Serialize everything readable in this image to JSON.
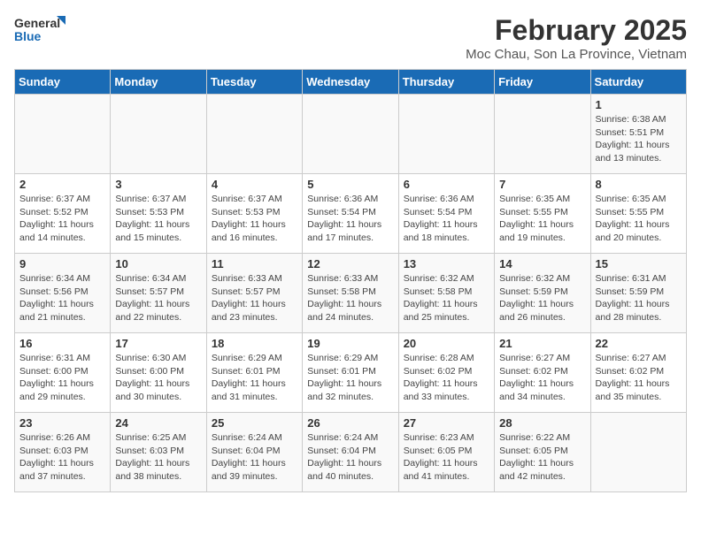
{
  "logo": {
    "general": "General",
    "blue": "Blue"
  },
  "title": "February 2025",
  "subtitle": "Moc Chau, Son La Province, Vietnam",
  "weekdays": [
    "Sunday",
    "Monday",
    "Tuesday",
    "Wednesday",
    "Thursday",
    "Friday",
    "Saturday"
  ],
  "weeks": [
    [
      {
        "day": "",
        "info": ""
      },
      {
        "day": "",
        "info": ""
      },
      {
        "day": "",
        "info": ""
      },
      {
        "day": "",
        "info": ""
      },
      {
        "day": "",
        "info": ""
      },
      {
        "day": "",
        "info": ""
      },
      {
        "day": "1",
        "info": "Sunrise: 6:38 AM\nSunset: 5:51 PM\nDaylight: 11 hours and 13 minutes."
      }
    ],
    [
      {
        "day": "2",
        "info": "Sunrise: 6:37 AM\nSunset: 5:52 PM\nDaylight: 11 hours and 14 minutes."
      },
      {
        "day": "3",
        "info": "Sunrise: 6:37 AM\nSunset: 5:53 PM\nDaylight: 11 hours and 15 minutes."
      },
      {
        "day": "4",
        "info": "Sunrise: 6:37 AM\nSunset: 5:53 PM\nDaylight: 11 hours and 16 minutes."
      },
      {
        "day": "5",
        "info": "Sunrise: 6:36 AM\nSunset: 5:54 PM\nDaylight: 11 hours and 17 minutes."
      },
      {
        "day": "6",
        "info": "Sunrise: 6:36 AM\nSunset: 5:54 PM\nDaylight: 11 hours and 18 minutes."
      },
      {
        "day": "7",
        "info": "Sunrise: 6:35 AM\nSunset: 5:55 PM\nDaylight: 11 hours and 19 minutes."
      },
      {
        "day": "8",
        "info": "Sunrise: 6:35 AM\nSunset: 5:55 PM\nDaylight: 11 hours and 20 minutes."
      }
    ],
    [
      {
        "day": "9",
        "info": "Sunrise: 6:34 AM\nSunset: 5:56 PM\nDaylight: 11 hours and 21 minutes."
      },
      {
        "day": "10",
        "info": "Sunrise: 6:34 AM\nSunset: 5:57 PM\nDaylight: 11 hours and 22 minutes."
      },
      {
        "day": "11",
        "info": "Sunrise: 6:33 AM\nSunset: 5:57 PM\nDaylight: 11 hours and 23 minutes."
      },
      {
        "day": "12",
        "info": "Sunrise: 6:33 AM\nSunset: 5:58 PM\nDaylight: 11 hours and 24 minutes."
      },
      {
        "day": "13",
        "info": "Sunrise: 6:32 AM\nSunset: 5:58 PM\nDaylight: 11 hours and 25 minutes."
      },
      {
        "day": "14",
        "info": "Sunrise: 6:32 AM\nSunset: 5:59 PM\nDaylight: 11 hours and 26 minutes."
      },
      {
        "day": "15",
        "info": "Sunrise: 6:31 AM\nSunset: 5:59 PM\nDaylight: 11 hours and 28 minutes."
      }
    ],
    [
      {
        "day": "16",
        "info": "Sunrise: 6:31 AM\nSunset: 6:00 PM\nDaylight: 11 hours and 29 minutes."
      },
      {
        "day": "17",
        "info": "Sunrise: 6:30 AM\nSunset: 6:00 PM\nDaylight: 11 hours and 30 minutes."
      },
      {
        "day": "18",
        "info": "Sunrise: 6:29 AM\nSunset: 6:01 PM\nDaylight: 11 hours and 31 minutes."
      },
      {
        "day": "19",
        "info": "Sunrise: 6:29 AM\nSunset: 6:01 PM\nDaylight: 11 hours and 32 minutes."
      },
      {
        "day": "20",
        "info": "Sunrise: 6:28 AM\nSunset: 6:02 PM\nDaylight: 11 hours and 33 minutes."
      },
      {
        "day": "21",
        "info": "Sunrise: 6:27 AM\nSunset: 6:02 PM\nDaylight: 11 hours and 34 minutes."
      },
      {
        "day": "22",
        "info": "Sunrise: 6:27 AM\nSunset: 6:02 PM\nDaylight: 11 hours and 35 minutes."
      }
    ],
    [
      {
        "day": "23",
        "info": "Sunrise: 6:26 AM\nSunset: 6:03 PM\nDaylight: 11 hours and 37 minutes."
      },
      {
        "day": "24",
        "info": "Sunrise: 6:25 AM\nSunset: 6:03 PM\nDaylight: 11 hours and 38 minutes."
      },
      {
        "day": "25",
        "info": "Sunrise: 6:24 AM\nSunset: 6:04 PM\nDaylight: 11 hours and 39 minutes."
      },
      {
        "day": "26",
        "info": "Sunrise: 6:24 AM\nSunset: 6:04 PM\nDaylight: 11 hours and 40 minutes."
      },
      {
        "day": "27",
        "info": "Sunrise: 6:23 AM\nSunset: 6:05 PM\nDaylight: 11 hours and 41 minutes."
      },
      {
        "day": "28",
        "info": "Sunrise: 6:22 AM\nSunset: 6:05 PM\nDaylight: 11 hours and 42 minutes."
      },
      {
        "day": "",
        "info": ""
      }
    ]
  ]
}
